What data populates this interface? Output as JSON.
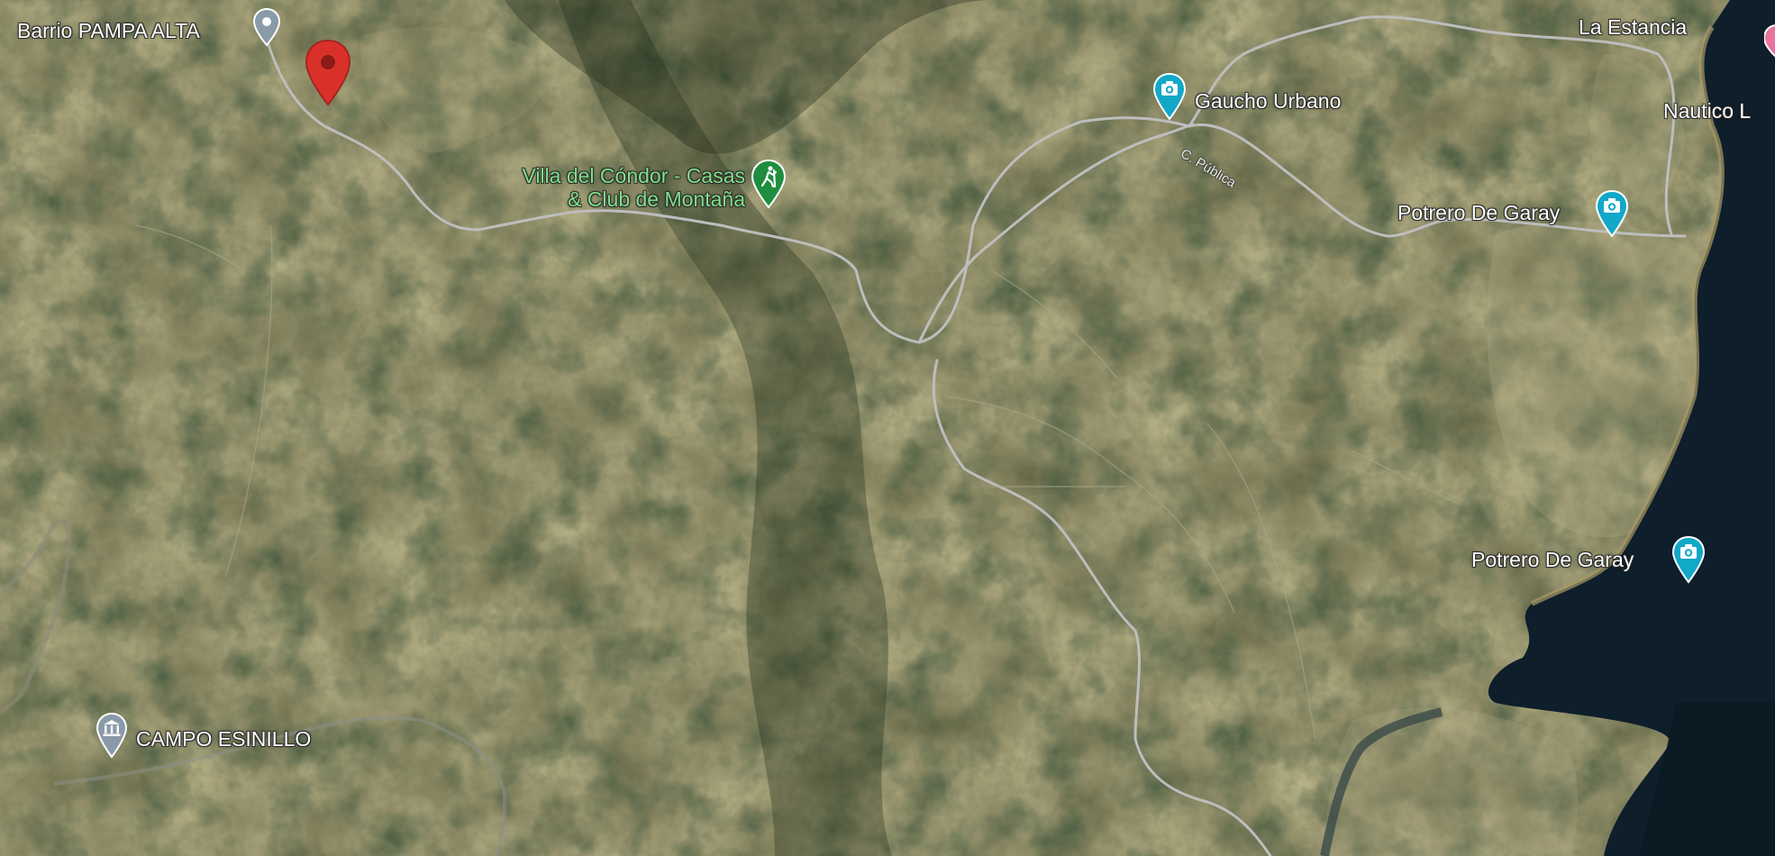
{
  "map": {
    "type": "satellite",
    "places": [
      {
        "id": "barrio-pampa-alta",
        "label": "Barrio PAMPA ALTA",
        "category": "neighborhood",
        "icon": "location-pin-icon",
        "color": "#8a9aa8"
      },
      {
        "id": "la-estancia",
        "label": "La Estancia",
        "category": "place",
        "icon": "none"
      },
      {
        "id": "gaucho-urbano",
        "label": "Gaucho Urbano",
        "category": "tourist-attraction",
        "icon": "camera-icon",
        "color": "#12a8c8"
      },
      {
        "id": "nautico",
        "label": "Nautico L",
        "category": "place",
        "icon": "none"
      },
      {
        "id": "villa-del-condor",
        "label_line1": "Villa del Cóndor - Casas",
        "label_line2": "& Club de Montaña",
        "category": "hiking",
        "icon": "hiking-icon",
        "color": "#1e8e3e"
      },
      {
        "id": "potrero-de-garay-1",
        "label": "Potrero De Garay",
        "category": "tourist-attraction",
        "icon": "camera-icon",
        "color": "#12a8c8"
      },
      {
        "id": "potrero-de-garay-2",
        "label": "Potrero De Garay",
        "category": "tourist-attraction",
        "icon": "camera-icon",
        "color": "#12a8c8"
      },
      {
        "id": "campo-esinillo",
        "label": "CAMPO ESINILLO",
        "category": "museum",
        "icon": "museum-icon",
        "color": "#8a9aa8"
      }
    ],
    "road_label": "C. Pública",
    "selected_pin": {
      "icon": "red-location-pin-icon",
      "color": "#d9302a"
    },
    "colors": {
      "water": "#0e1e2a",
      "road": "#b8b8b8",
      "terrain_base": "#5a5a3c"
    }
  }
}
